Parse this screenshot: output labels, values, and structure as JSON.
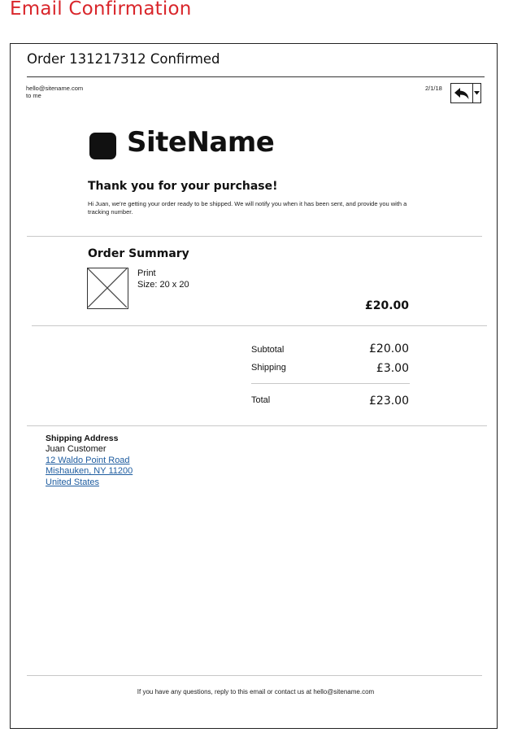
{
  "page": {
    "heading": "Email Confirmation"
  },
  "email": {
    "subject": "Order 131217312 Confirmed",
    "from": "hello@sitename.com",
    "to": "to me",
    "date": "2/1/18"
  },
  "brand": {
    "name": "SiteName"
  },
  "message": {
    "headline": "Thank you for your purchase!",
    "body": "Hi Juan, we're getting your order ready to be shipped. We will notify you when it has been sent, and provide you with a tracking number."
  },
  "summary": {
    "title": "Order Summary",
    "items": [
      {
        "name": "Print",
        "size": "Size: 20 x 20",
        "price": "£20.00"
      }
    ],
    "totals": [
      {
        "label": "Subtotal",
        "value": "£20.00"
      },
      {
        "label": "Shipping",
        "value": "£3.00"
      },
      {
        "label": "Total",
        "value": "£23.00"
      }
    ]
  },
  "shipping": {
    "title": "Shipping Address",
    "name": "Juan Customer",
    "street": "12 Waldo Point Road",
    "city": "Mishauken, NY 11200",
    "country": "United States"
  },
  "footer": {
    "text": "If you have any questions, reply to this email or contact us at hello@sitename.com"
  },
  "icons": {
    "reply": "reply-icon",
    "more": "chevron-down-icon",
    "image_placeholder": "image-placeholder-icon"
  }
}
